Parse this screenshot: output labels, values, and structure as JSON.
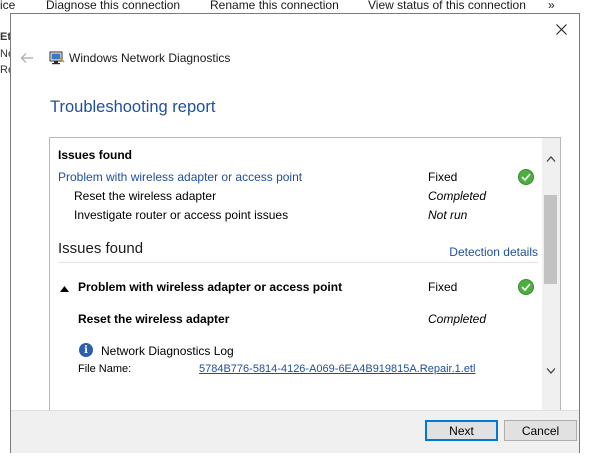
{
  "background": {
    "toolbar_items": [
      "ice",
      "Diagnose this connection",
      "Rename this connection",
      "View status of this connection",
      "»"
    ],
    "left_fragments": [
      "Eth",
      "Ne",
      "Re"
    ]
  },
  "dialog": {
    "app_title": "Windows Network Diagnostics",
    "report_title": "Troubleshooting report",
    "summary": {
      "heading": "Issues found",
      "problem": {
        "label": "Problem with wireless adapter or access point",
        "status": "Fixed"
      },
      "steps": [
        {
          "label": "Reset the wireless adapter",
          "status": "Completed"
        },
        {
          "label": "Investigate router or access point issues",
          "status": "Not run"
        }
      ]
    },
    "details": {
      "heading": "Issues found",
      "detection_link": "Detection details",
      "problem": {
        "label": "Problem with wireless adapter or access point",
        "status": "Fixed"
      },
      "step": {
        "label": "Reset the wireless adapter",
        "status": "Completed"
      },
      "log_title": "Network Diagnostics Log",
      "file_label": "File Name:",
      "file_value": "5784B776-5814-4126-A069-6EA4B919815A.Repair.1.etl"
    },
    "buttons": {
      "next": "Next",
      "cancel": "Cancel"
    }
  },
  "colors": {
    "accent": "#1e4f9b",
    "check": "#4caf3f",
    "footer_bg": "#f0f0f0"
  }
}
